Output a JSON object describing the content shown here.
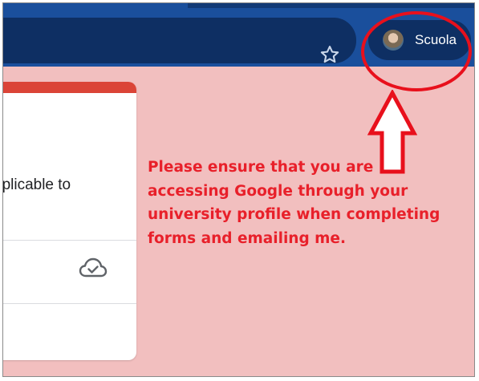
{
  "profile": {
    "name": "Scuola"
  },
  "card": {
    "partial_text": "pplicable to"
  },
  "notice": {
    "text": "Please ensure that you are accessing Google through your university profile when completing forms and emailing me."
  },
  "icons": {
    "bookmark": "star-icon",
    "saved": "cloud-check-icon",
    "profile": "avatar"
  },
  "colors": {
    "browser_bar": "#1a4f9c",
    "background": "#f2bfbf",
    "card_accent": "#db4437",
    "annotation": "#e8202a"
  }
}
